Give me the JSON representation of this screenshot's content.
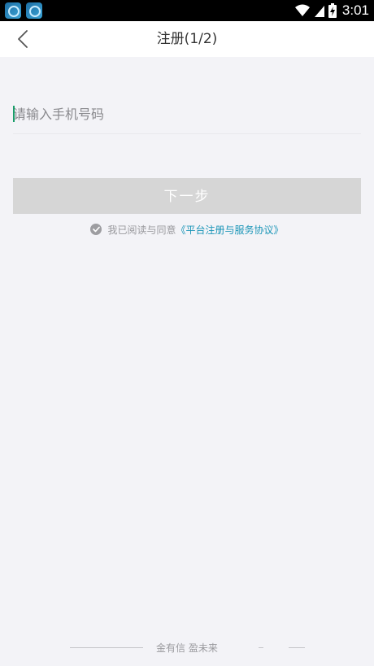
{
  "status_bar": {
    "time": "3:01",
    "icons": [
      "app-icon-1",
      "app-icon-2",
      "wifi-icon",
      "signal-icon",
      "battery-charging-icon"
    ]
  },
  "header": {
    "back_icon": "chevron-left-icon",
    "title": "注册(1/2)"
  },
  "phone": {
    "placeholder": "请输入手机号码",
    "value": ""
  },
  "next_button": {
    "label": "下一步",
    "enabled": false
  },
  "agreement": {
    "checked": true,
    "prefix": "我已阅读与同意",
    "link_text": "《平台注册与服务协议》"
  },
  "footer": {
    "slogan": "金有信 盈未来"
  },
  "colors": {
    "background": "#f3f3f7",
    "header": "#ffffff",
    "disabled_button": "#d6d6d6",
    "link": "#1c96b8",
    "caret": "#1a9d6a"
  }
}
